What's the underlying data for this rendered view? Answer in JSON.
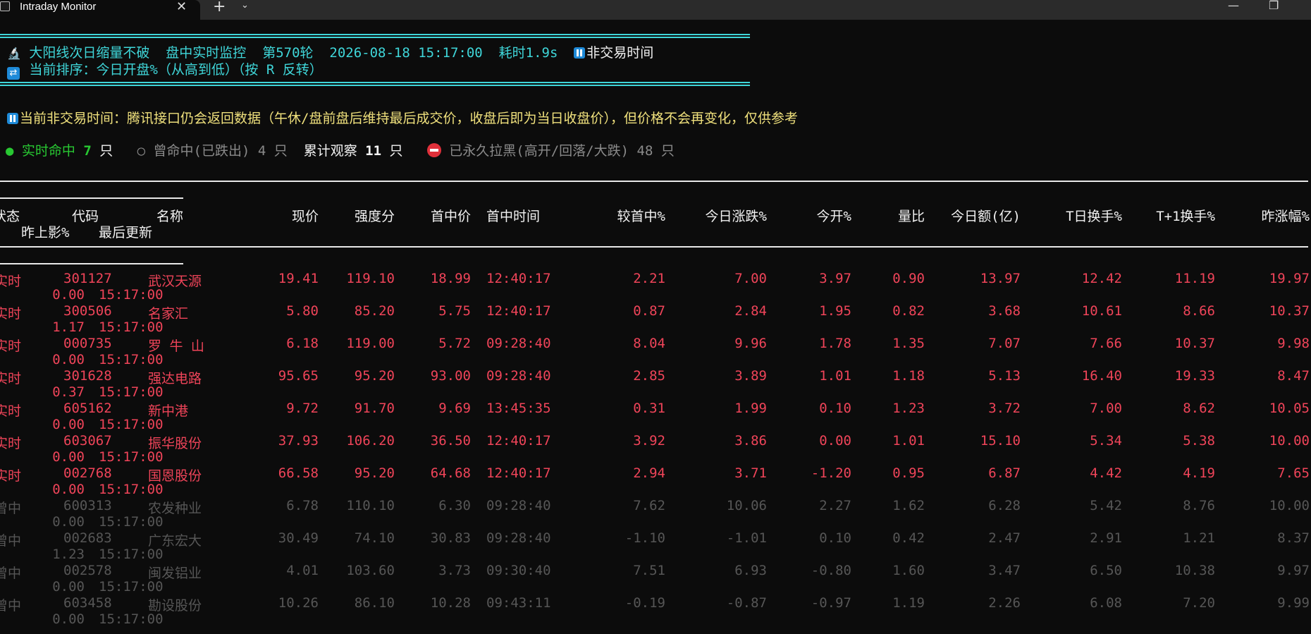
{
  "window": {
    "tab_title": "Intraday Monitor",
    "close_glyph": "✕",
    "new_tab_glyph": "+",
    "menu_glyph": "⌄",
    "minimize_glyph": "—",
    "restore_glyph": "❐"
  },
  "banner": {
    "icon": "🔬",
    "strategy": "大阳线次日缩量不破",
    "mode": "盘中实时监控",
    "round": "第570轮",
    "datetime": "2026-08-18 15:17:00",
    "elapsed": "耗时1.9s",
    "status": "非交易时间",
    "sort_icon": "🔀",
    "sort_text": "当前排序：今日开盘%（从高到低）（按 R 反转）"
  },
  "notice": "当前非交易时间：腾讯接口仍会返回数据（午休/盘前盘后维持最后成交价，收盘后即为当日收盘价），但价格不会再变化，仅供参考",
  "summary": {
    "live_label": "实时命中",
    "live_count": "7",
    "unit": "只",
    "past_label": "曾命中(已跌出)",
    "past_count": "4",
    "total_label": "累计观察",
    "total_count": "11",
    "banned_label": "已永久拉黑(高开/回落/大跌)",
    "banned_count": "48"
  },
  "columns": [
    "状态",
    "代码",
    "名称",
    "现价",
    "强度分",
    "首中价",
    "首中时间",
    "较首中%",
    "今日涨跌%",
    "今开%",
    "量比",
    "今日额(亿)",
    "T日换手%",
    "T+1换手%",
    "昨涨幅%",
    "昨上影%",
    "最后更新"
  ],
  "rows": [
    {
      "kind": "live",
      "cells": [
        "实时",
        "301127",
        "武汉天源",
        "19.41",
        "119.10",
        "18.99",
        "12:40:17",
        "2.21",
        "7.00",
        "3.97",
        "0.90",
        "13.97",
        "12.42",
        "11.19",
        "19.97",
        "0.00",
        "15:17:00"
      ]
    },
    {
      "kind": "live",
      "cells": [
        "实时",
        "300506",
        "名家汇",
        "5.80",
        "85.20",
        "5.75",
        "12:40:17",
        "0.87",
        "2.84",
        "1.95",
        "0.82",
        "3.68",
        "10.61",
        "8.66",
        "10.37",
        "1.17",
        "15:17:00"
      ]
    },
    {
      "kind": "live",
      "cells": [
        "实时",
        "000735",
        "罗 牛 山",
        "6.18",
        "119.00",
        "5.72",
        "09:28:40",
        "8.04",
        "9.96",
        "1.78",
        "1.35",
        "7.07",
        "7.66",
        "10.37",
        "9.98",
        "0.00",
        "15:17:00"
      ]
    },
    {
      "kind": "live",
      "cells": [
        "实时",
        "301628",
        "强达电路",
        "95.65",
        "95.20",
        "93.00",
        "09:28:40",
        "2.85",
        "3.89",
        "1.01",
        "1.18",
        "5.13",
        "16.40",
        "19.33",
        "8.47",
        "0.37",
        "15:17:00"
      ]
    },
    {
      "kind": "live",
      "cells": [
        "实时",
        "605162",
        "新中港",
        "9.72",
        "91.70",
        "9.69",
        "13:45:35",
        "0.31",
        "1.99",
        "0.10",
        "1.23",
        "3.72",
        "7.00",
        "8.62",
        "10.05",
        "0.00",
        "15:17:00"
      ]
    },
    {
      "kind": "live",
      "cells": [
        "实时",
        "603067",
        "振华股份",
        "37.93",
        "106.20",
        "36.50",
        "12:40:17",
        "3.92",
        "3.86",
        "0.00",
        "1.01",
        "15.10",
        "5.34",
        "5.38",
        "10.00",
        "0.00",
        "15:17:00"
      ]
    },
    {
      "kind": "live",
      "cells": [
        "实时",
        "002768",
        "国恩股份",
        "66.58",
        "95.20",
        "64.68",
        "12:40:17",
        "2.94",
        "3.71",
        "-1.20",
        "0.95",
        "6.87",
        "4.42",
        "4.19",
        "7.65",
        "0.00",
        "15:17:00"
      ]
    },
    {
      "kind": "past",
      "cells": [
        "曾中",
        "600313",
        "农发种业",
        "6.78",
        "110.10",
        "6.30",
        "09:28:40",
        "7.62",
        "10.06",
        "2.27",
        "1.62",
        "6.28",
        "5.42",
        "8.76",
        "10.00",
        "0.00",
        "15:17:00"
      ]
    },
    {
      "kind": "past",
      "cells": [
        "曾中",
        "002683",
        "广东宏大",
        "30.49",
        "74.10",
        "30.83",
        "09:28:40",
        "-1.10",
        "-1.01",
        "0.10",
        "0.42",
        "2.47",
        "2.91",
        "1.21",
        "8.37",
        "1.23",
        "15:17:00"
      ]
    },
    {
      "kind": "past",
      "cells": [
        "曾中",
        "002578",
        "闽发铝业",
        "4.01",
        "103.60",
        "3.73",
        "09:30:40",
        "7.51",
        "6.93",
        "-0.80",
        "1.60",
        "3.47",
        "6.50",
        "10.38",
        "9.97",
        "0.00",
        "15:17:00"
      ]
    },
    {
      "kind": "past",
      "cells": [
        "曾中",
        "603458",
        "勘设股份",
        "10.26",
        "86.10",
        "10.28",
        "09:43:11",
        "-0.19",
        "-0.87",
        "-0.97",
        "1.19",
        "2.26",
        "6.08",
        "7.20",
        "9.99",
        "0.00",
        "15:17:00"
      ]
    }
  ],
  "colors": {
    "live": "#ef4459",
    "past": "#565656",
    "accent": "#3fd6d9",
    "notice": "#efe07c"
  }
}
